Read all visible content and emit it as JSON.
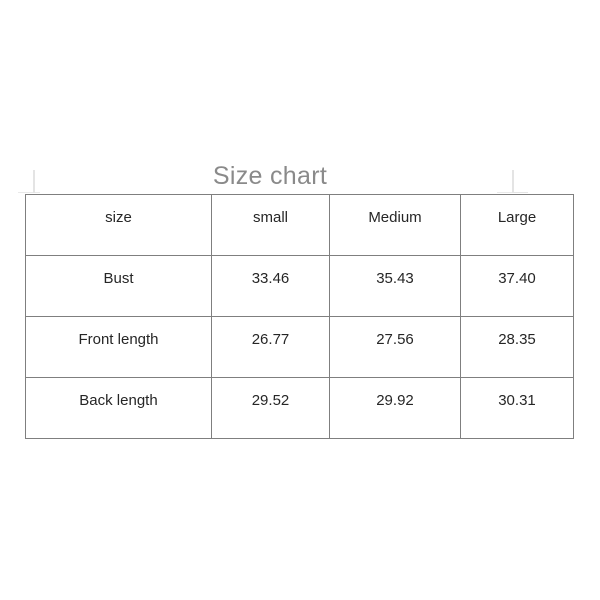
{
  "title": "Size chart",
  "colors": {
    "title": "#8a8a8a",
    "text": "#262626",
    "border": "#7f7f7f",
    "background": "#ffffff",
    "mark": "#e4e4e4"
  },
  "chart_data": {
    "type": "table",
    "title": "Size chart",
    "columns": [
      "size",
      "small",
      "Medium",
      "Large"
    ],
    "rows": [
      {
        "label": "Bust",
        "values": [
          "33.46",
          "35.43",
          "37.40"
        ]
      },
      {
        "label": "Front length",
        "values": [
          "26.77",
          "27.56",
          "28.35"
        ]
      },
      {
        "label": "Back length",
        "values": [
          "29.52",
          "29.92",
          "30.31"
        ]
      }
    ]
  },
  "table": {
    "header": {
      "label": "size",
      "small": "small",
      "medium": "Medium",
      "large": "Large"
    },
    "rows": [
      {
        "label": "Bust",
        "small": "33.46",
        "medium": "35.43",
        "large": "37.40"
      },
      {
        "label": "Front length",
        "small": "26.77",
        "medium": "27.56",
        "large": "28.35"
      },
      {
        "label": "Back length",
        "small": "29.52",
        "medium": "29.92",
        "large": "30.31"
      }
    ]
  }
}
